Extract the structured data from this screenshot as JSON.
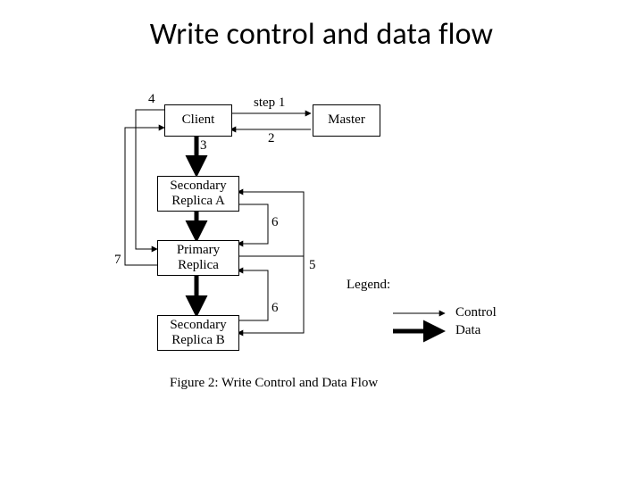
{
  "title": "Write control and data flow",
  "nodes": {
    "client": "Client",
    "master": "Master",
    "secA": "Secondary\nReplica A",
    "primary": "Primary\nReplica",
    "secB": "Secondary\nReplica B"
  },
  "steps": {
    "s1": "step 1",
    "s2": "2",
    "s3": "3",
    "s4": "4",
    "s5": "5",
    "s6a": "6",
    "s6b": "6",
    "s7": "7"
  },
  "legend": {
    "title": "Legend:",
    "control": "Control",
    "data": "Data"
  },
  "caption": "Figure 2: Write Control and Data Flow"
}
